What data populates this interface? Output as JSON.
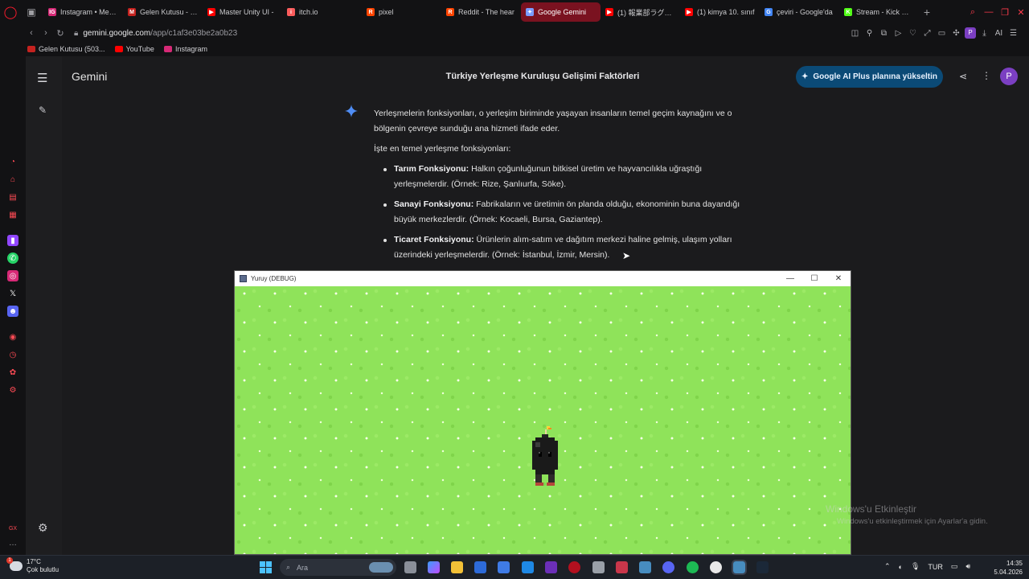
{
  "browser": {
    "tabs": [
      {
        "label": "Instagram • Mesaj",
        "fav": "IG",
        "color": "#d62976",
        "active": false
      },
      {
        "label": "Gelen Kutusu - ke",
        "fav": "M",
        "color": "#c5221f",
        "active": false
      },
      {
        "label": "Master Unity UI -",
        "fav": "▶",
        "color": "#ff0000",
        "active": false
      },
      {
        "label": "itch.io",
        "fav": "i",
        "color": "#fa5c5c",
        "active": false
      },
      {
        "label": "pixel",
        "fav": "R",
        "color": "#ff4500",
        "active": false
      },
      {
        "label": "Reddit - The hear",
        "fav": "R",
        "color": "#ff4500",
        "active": false
      },
      {
        "label": "Google Gemini",
        "fav": "✦",
        "color": "#7a9cff",
        "active": true
      },
      {
        "label": "(1) 報業部ラグトレ",
        "fav": "▶",
        "color": "#ff0000",
        "active": false
      },
      {
        "label": "(1) kimya 10. sınıf",
        "fav": "▶",
        "color": "#ff0000",
        "active": false
      },
      {
        "label": "çeviri - Google'da",
        "fav": "G",
        "color": "#4285f4",
        "active": false
      },
      {
        "label": "Stream - Kick Das",
        "fav": "K",
        "color": "#53fc18",
        "active": false
      }
    ],
    "url_host": "gemini.google.com",
    "url_path": "/app/c1af3e03be2a0b23",
    "ai_label": "AI",
    "profile_initial": "P",
    "bookmarks": [
      {
        "label": "Gelen Kutusu (503...",
        "color": "#c5221f"
      },
      {
        "label": "YouTube",
        "color": "#ff0000"
      },
      {
        "label": "Instagram",
        "color": "#d62976"
      }
    ]
  },
  "gemini": {
    "brand": "Gemini",
    "chat_title": "Türkiye Yerleşme Kuruluşu Gelişimi Faktörleri",
    "upgrade_label": "Google AI Plus planına yükseltin",
    "avatar_initial": "P",
    "intro": "Yerleşmelerin fonksiyonları, o yerleşim biriminde yaşayan insanların temel geçim kaynağını ve o bölgenin çevreye sunduğu ana hizmeti ifade eder.",
    "list_heading": "İşte en temel yerleşme fonksiyonları:",
    "items": [
      {
        "title": "Tarım Fonksiyonu:",
        "text": " Halkın çoğunluğunun bitkisel üretim ve hayvancılıkla uğraştığı yerleşmelerdir. (Örnek: Rize, Şanlıurfa, Söke)."
      },
      {
        "title": "Sanayi Fonksiyonu:",
        "text": " Fabrikaların ve üretimin ön planda olduğu, ekonominin buna dayandığı büyük merkezlerdir. (Örnek: Kocaeli, Bursa, Gaziantep)."
      },
      {
        "title": "Ticaret Fonksiyonu:",
        "text": " Ürünlerin alım-satım ve dağıtım merkezi haline gelmiş, ulaşım yolları üzerindeki yerleşmelerdir. (Örnek: İstanbul, İzmir, Mersin)."
      }
    ]
  },
  "game_window": {
    "title": "Yuruy (DEBUG)",
    "minimize": "—",
    "maximize": "☐",
    "close": "✕"
  },
  "watermark": {
    "line1": "Windows'u Etkinleştir",
    "line2": "Windows'u etkinleştirmek için Ayarlar'a gidin."
  },
  "taskbar": {
    "weather_temp": "17°C",
    "weather_desc": "Çok bulutlu",
    "weather_badge": "1",
    "search_placeholder": "Ara",
    "language": "TUR",
    "time": "14:35",
    "date": "5.04.2026"
  }
}
